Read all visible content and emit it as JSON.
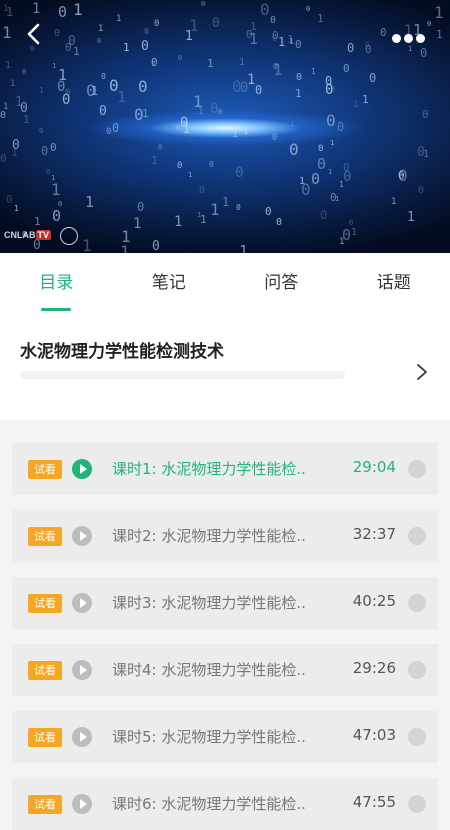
{
  "video": {
    "logo_text": "CNLAB",
    "logo_badge": "TV"
  },
  "tabs": [
    {
      "label": "目录",
      "active": true
    },
    {
      "label": "笔记",
      "active": false
    },
    {
      "label": "问答",
      "active": false
    },
    {
      "label": "话题",
      "active": false
    }
  ],
  "course": {
    "title": "水泥物理力学性能检测技术"
  },
  "lessons": [
    {
      "tag": "试看",
      "title": "课时1: 水泥物理力学性能检..",
      "duration": "29:04",
      "active": true
    },
    {
      "tag": "试看",
      "title": "课时2: 水泥物理力学性能检..",
      "duration": "32:37",
      "active": false
    },
    {
      "tag": "试看",
      "title": "课时3: 水泥物理力学性能检..",
      "duration": "40:25",
      "active": false
    },
    {
      "tag": "试看",
      "title": "课时4: 水泥物理力学性能检..",
      "duration": "29:26",
      "active": false
    },
    {
      "tag": "试看",
      "title": "课时5: 水泥物理力学性能检..",
      "duration": "47:03",
      "active": false
    },
    {
      "tag": "试看",
      "title": "课时6: 水泥物理力学性能检..",
      "duration": "47:55",
      "active": false
    }
  ],
  "colors": {
    "accent": "#1fb57a",
    "tag": "#f5a623"
  }
}
